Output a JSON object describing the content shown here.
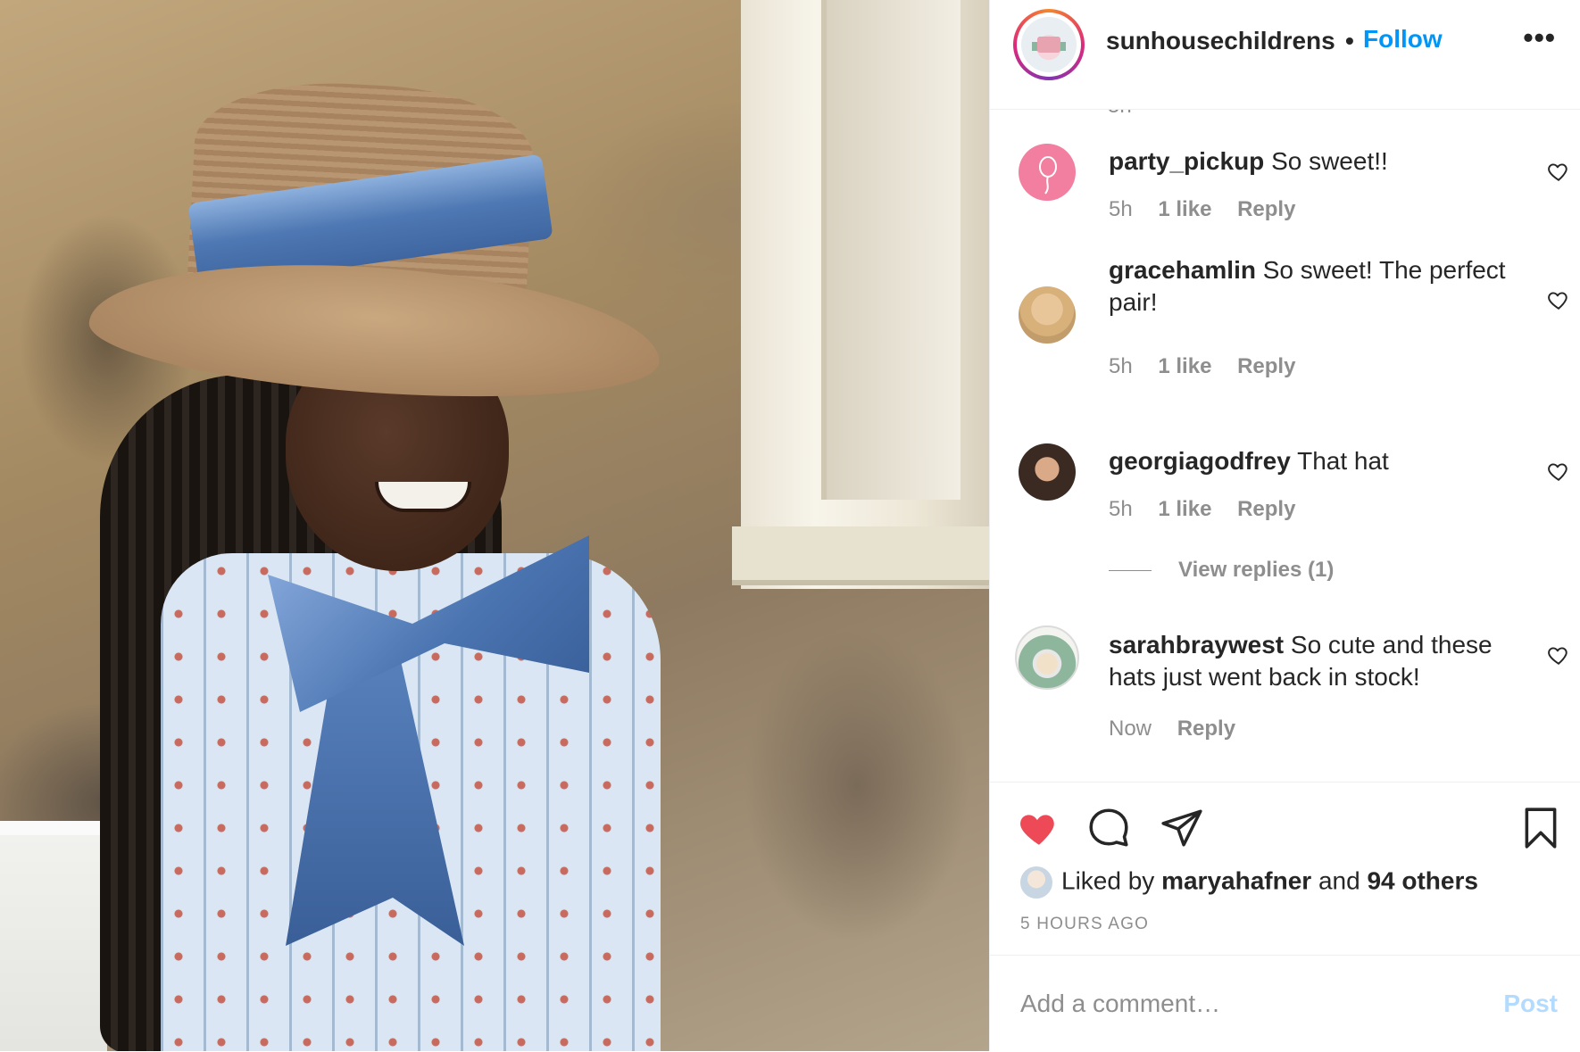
{
  "header": {
    "username": "sunhousechildrens",
    "dot": "•",
    "follow_label": "Follow",
    "more_label": "•••",
    "avatar_icon": "brand-logo"
  },
  "comments": {
    "clipped_time": "5h",
    "items": [
      {
        "username": "party_pickup",
        "text": "So sweet!!",
        "time": "5h",
        "likes": "1 like",
        "reply": "Reply"
      },
      {
        "username": "gracehamlin",
        "text": "So sweet! The perfect pair!",
        "time": "5h",
        "likes": "1 like",
        "reply": "Reply"
      },
      {
        "username": "georgiagodfrey",
        "text": "That hat",
        "time": "5h",
        "likes": "1 like",
        "reply": "Reply",
        "view_replies": "View replies (1)"
      },
      {
        "username": "sarahbraywest",
        "text": "So cute and these hats just went back in stock!",
        "time": "Now",
        "reply": "Reply"
      }
    ]
  },
  "actions": {
    "liked_by_prefix": "Liked by",
    "liked_by_user": "maryahafner",
    "liked_by_and": "and",
    "liked_by_others": "94 others",
    "time_ago": "5 HOURS AGO",
    "icons": [
      "heart-filled-icon",
      "comment-icon",
      "share-icon",
      "bookmark-icon"
    ],
    "heart_color": "#ed4956"
  },
  "add_comment": {
    "placeholder": "Add a comment…",
    "post_label": "Post"
  },
  "colors": {
    "accent": "#0095f6",
    "muted": "#8e8e8e",
    "post_disabled": "#b3dbff"
  }
}
